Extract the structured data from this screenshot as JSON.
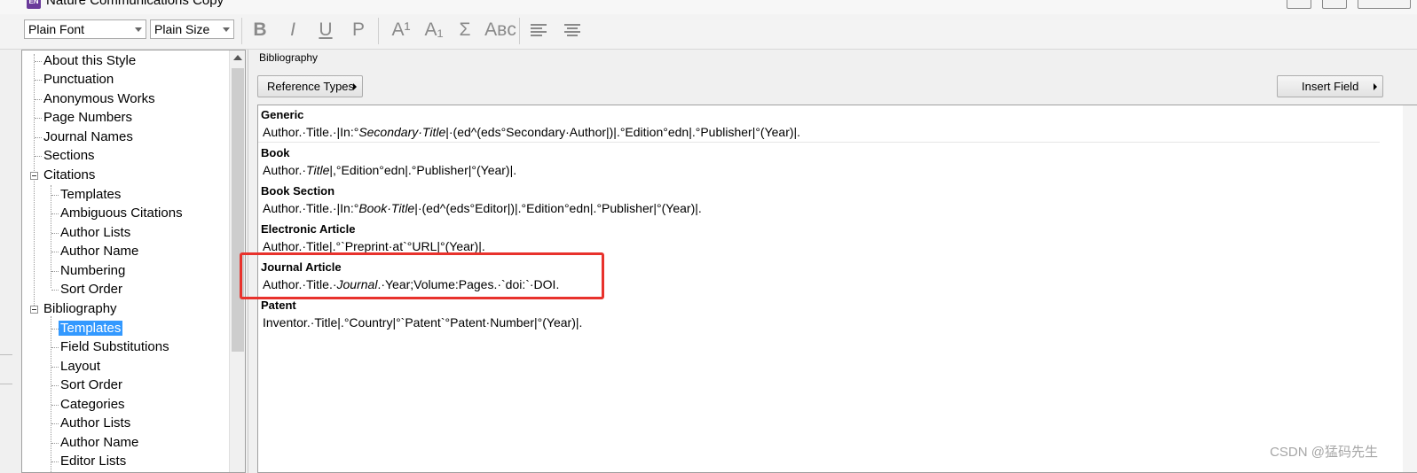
{
  "window": {
    "title": "Nature Communications Copy",
    "app_icon_text": "EN"
  },
  "toolbar": {
    "font": "Plain Font",
    "size": "Plain Size",
    "buttons": [
      "B",
      "I",
      "U",
      "P",
      "A¹",
      "A₁",
      "Σ",
      "Aʙᴄ"
    ]
  },
  "tree": {
    "items": [
      {
        "label": "About this Style"
      },
      {
        "label": "Punctuation"
      },
      {
        "label": "Anonymous Works"
      },
      {
        "label": "Page Numbers"
      },
      {
        "label": "Journal Names"
      },
      {
        "label": "Sections"
      },
      {
        "label": "Citations"
      },
      {
        "label": "Templates"
      },
      {
        "label": "Ambiguous Citations"
      },
      {
        "label": "Author Lists"
      },
      {
        "label": "Author Name"
      },
      {
        "label": "Numbering"
      },
      {
        "label": "Sort Order"
      },
      {
        "label": "Bibliography"
      },
      {
        "label": "Templates"
      },
      {
        "label": "Field Substitutions"
      },
      {
        "label": "Layout"
      },
      {
        "label": "Sort Order"
      },
      {
        "label": "Categories"
      },
      {
        "label": "Author Lists"
      },
      {
        "label": "Author Name"
      },
      {
        "label": "Editor Lists"
      }
    ]
  },
  "panel": {
    "section": "Bibliography",
    "reference_types_button": "Reference Types",
    "insert_field_button": "Insert Field",
    "templates": [
      {
        "type": "Generic",
        "parts": [
          "Author.·Title.·|In:°",
          "Secondary·Title",
          "|·(ed^(eds°Secondary·Author|)|.°Edition°edn|.°Publisher|°(Year)|."
        ]
      },
      {
        "type": "Book",
        "parts": [
          "Author.·",
          "Title",
          "|,°Edition°edn|.°Publisher|°(Year)|."
        ]
      },
      {
        "type": "Book Section",
        "parts": [
          "Author.·Title.·|In:°",
          "Book·Title",
          "|·(ed^(eds°Editor|)|.°Edition°edn|.°Publisher|°(Year)|."
        ]
      },
      {
        "type": "Electronic Article",
        "parts": [
          "Author.·Title|.°`Preprint·at`°URL|°(Year)|.",
          "",
          ""
        ]
      },
      {
        "type": "Journal Article",
        "parts": [
          "Author.·Title.·",
          "Journal",
          ".·Year;Volume:Pages.·`doi:`·DOI."
        ]
      },
      {
        "type": "Patent",
        "parts": [
          "Inventor.·Title|.°Country|°`Patent`°Patent·Number|°(Year)|.",
          "",
          ""
        ]
      }
    ]
  },
  "watermark": "CSDN @猛码先生",
  "colors": {
    "highlight": "#e8322c",
    "selection": "#3399ff"
  }
}
